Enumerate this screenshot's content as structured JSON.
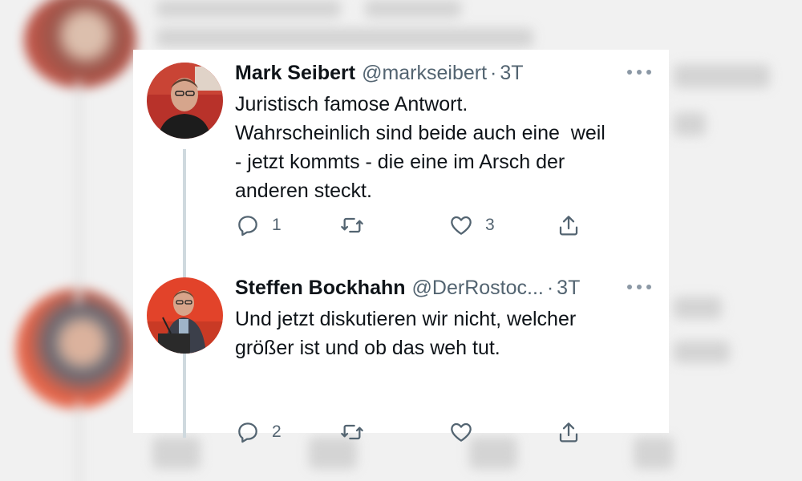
{
  "thread": [
    {
      "name": "Mark Seibert",
      "handle": "@markseibert",
      "separator": "·",
      "time": "3T",
      "text_lines": [
        "Juristisch famose Antwort.",
        "Wahrscheinlich sind beide auch eine  weil",
        "- jetzt kommts - die eine im Arsch der",
        "anderen steckt."
      ],
      "replies": "1",
      "retweets": "",
      "likes": "3",
      "avatar_icon": "avatar-photo"
    },
    {
      "name": "Steffen Bockhahn",
      "handle": "@DerRostoc...",
      "separator": "·",
      "time": "3T",
      "text_lines": [
        "Und jetzt diskutieren wir nicht, welcher",
        "größer ist und ob das weh tut."
      ],
      "replies": "2",
      "retweets": "",
      "likes": "",
      "avatar_icon": "avatar-photo"
    }
  ],
  "icons": {
    "reply": "speech-bubble-icon",
    "retweet": "retweet-arrows-icon",
    "like": "heart-outline-icon",
    "share": "share-upload-icon",
    "more": "three-dots-icon"
  },
  "colors": {
    "text": "#0f1419",
    "secondary": "#536471",
    "thread_line": "#cfd9de",
    "background_blur": "#f1f1f1"
  }
}
